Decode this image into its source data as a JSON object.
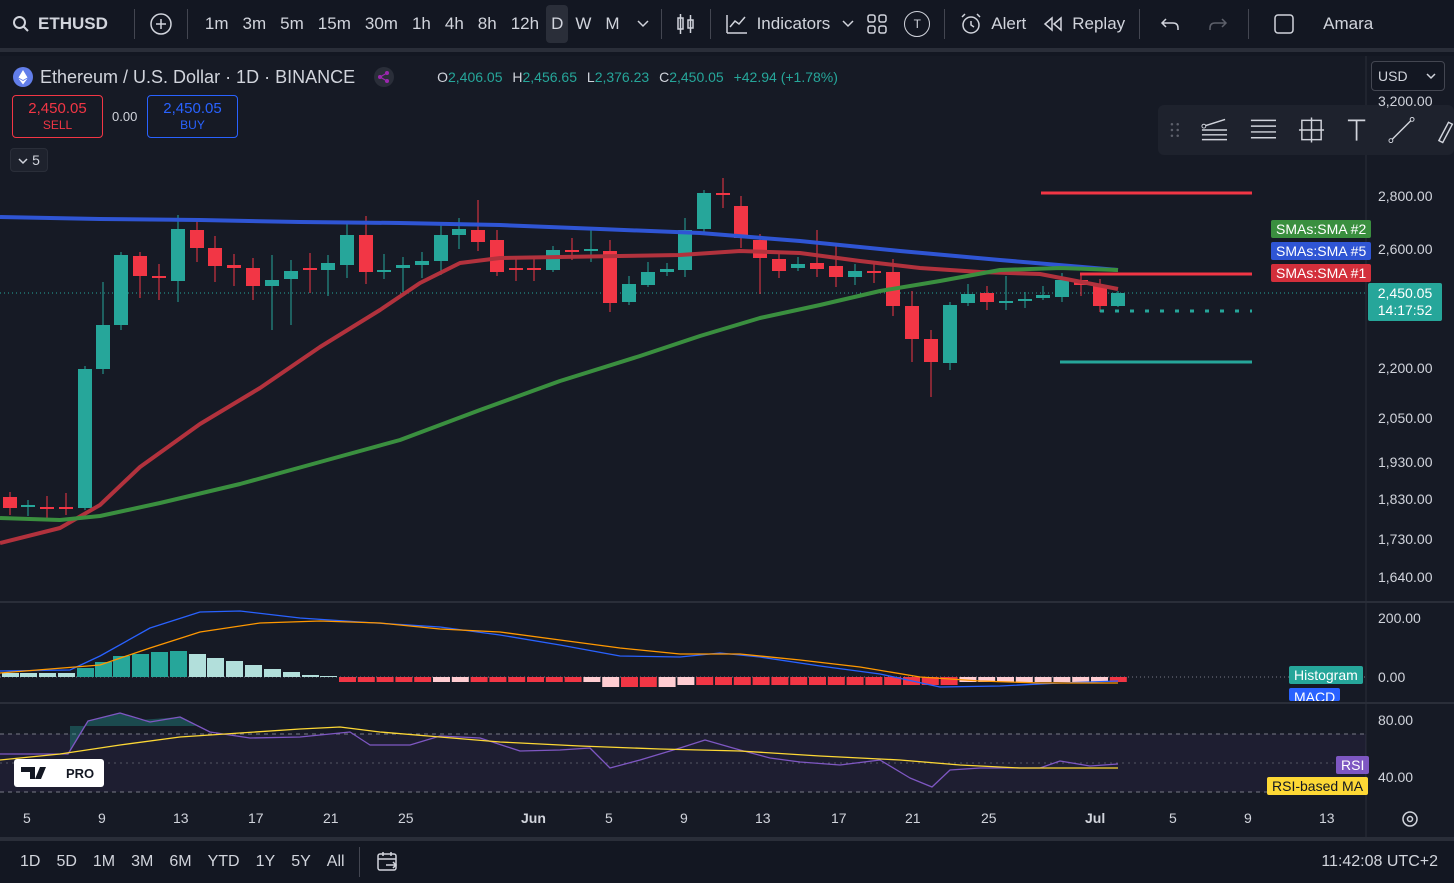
{
  "topbar": {
    "symbol": "ETHUSD",
    "timeframes": [
      "1m",
      "3m",
      "5m",
      "15m",
      "30m",
      "1h",
      "4h",
      "8h",
      "12h",
      "D",
      "W",
      "M"
    ],
    "active_timeframe": "D",
    "indicators_label": "Indicators",
    "alert_label": "Alert",
    "replay_label": "Replay",
    "user_label": "Amara",
    "t_badge": "T"
  },
  "legend": {
    "title": "Ethereum / U.S. Dollar · 1D · BINANCE",
    "o_label": "O",
    "o_val": "2,406.05",
    "h_label": "H",
    "h_val": "2,456.65",
    "l_label": "L",
    "l_val": "2,376.23",
    "c_label": "C",
    "c_val": "2,450.05",
    "change": "+42.94 (+1.78%)"
  },
  "trade": {
    "sell_price": "2,450.05",
    "sell_label": "SELL",
    "buy_price": "2,450.05",
    "buy_label": "BUY",
    "spread": "0.00"
  },
  "collapse_count": "5",
  "currency": "USD",
  "price_axis": [
    "3,200.00",
    "2,800.00",
    "2,600.00",
    "2,200.00",
    "2,050.00",
    "1,930.00",
    "1,830.00",
    "1,730.00",
    "1,640.00"
  ],
  "current_price": "2,450.05",
  "countdown": "14:17:52",
  "sma_labels": {
    "sma2": "SMAs:SMA #2",
    "sma5": "SMAs:SMA #5",
    "sma1": "SMAs:SMA #1"
  },
  "macd_axis": [
    "200.00",
    "0.00"
  ],
  "macd_labels": {
    "histogram": "Histogram",
    "macd": "MACD"
  },
  "rsi_axis": [
    "80.00",
    "40.00"
  ],
  "rsi_labels": {
    "rsi": "RSI",
    "rsi_ma": "RSI-based MA"
  },
  "pro_badge": "PRO",
  "x_axis": [
    "5",
    "9",
    "13",
    "17",
    "21",
    "25",
    "Jun",
    "5",
    "9",
    "13",
    "17",
    "21",
    "25",
    "Jul",
    "5",
    "9",
    "13"
  ],
  "bottombar": {
    "ranges": [
      "1D",
      "5D",
      "1M",
      "3M",
      "6M",
      "YTD",
      "1Y",
      "5Y",
      "All"
    ],
    "clock": "11:42:08 UTC+2"
  },
  "colors": {
    "up": "#26a69a",
    "down": "#f23645",
    "sma1": "#b2323d",
    "sma2": "#3a8f3f",
    "sma5": "#2f55d4",
    "macd": "#2962ff",
    "signal": "#ff9800",
    "rsi": "#7e57c2",
    "rsi_ma": "#fdd835"
  }
}
